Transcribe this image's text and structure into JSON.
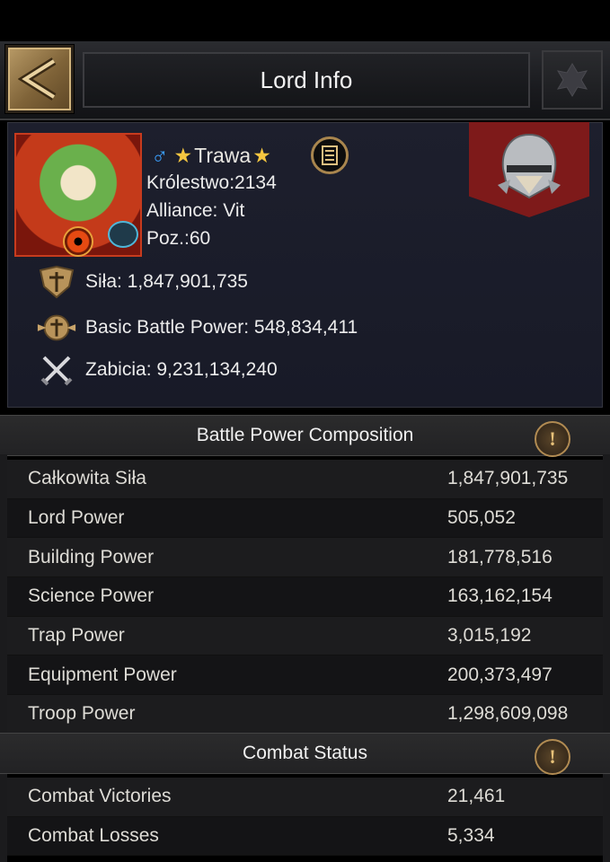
{
  "header": {
    "title": "Lord Info"
  },
  "profile": {
    "name": "Trawa",
    "kingdom": "Królestwo:2134",
    "alliance": "Alliance: Vit",
    "level": "Poz.:60"
  },
  "stats": [
    {
      "icon": "power-shield-icon",
      "text": "Siła: 1,847,901,735"
    },
    {
      "icon": "battle-power-emblem-icon",
      "text": "Basic Battle Power: 548,834,411"
    },
    {
      "icon": "crossed-swords-icon",
      "text": "Zabicia: 9,231,134,240"
    }
  ],
  "battle_power": {
    "title": "Battle Power Composition",
    "rows": [
      {
        "label": "Całkowita Siła",
        "value": "1,847,901,735"
      },
      {
        "label": "Lord Power",
        "value": "505,052"
      },
      {
        "label": "Building Power",
        "value": "181,778,516"
      },
      {
        "label": "Science Power",
        "value": "163,162,154"
      },
      {
        "label": "Trap Power",
        "value": "3,015,192"
      },
      {
        "label": "Equipment Power",
        "value": "200,373,497"
      },
      {
        "label": "Troop Power",
        "value": "1,298,609,098"
      }
    ]
  },
  "combat": {
    "title": "Combat Status",
    "rows": [
      {
        "label": "Combat Victories",
        "value": "21,461"
      },
      {
        "label": "Combat Losses",
        "value": "5,334"
      }
    ]
  },
  "colors": {
    "accent_gold": "#a9864e",
    "banner_red": "#7e1a1a",
    "male_blue": "#3aa0ff"
  }
}
